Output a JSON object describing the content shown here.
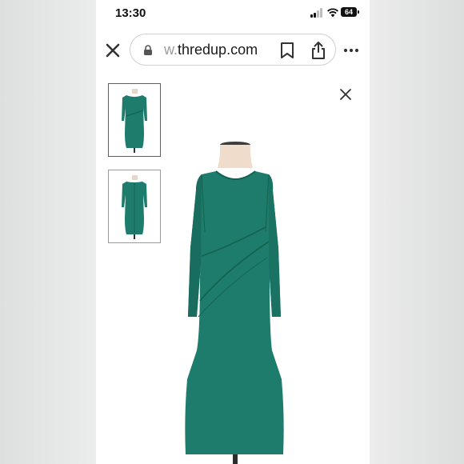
{
  "status_bar": {
    "time": "13:30",
    "battery": "64"
  },
  "browser": {
    "url_prefix": "w.",
    "url_domain": "thredup.com",
    "icons": [
      "close-icon",
      "lock-icon",
      "bookmark-icon",
      "share-icon",
      "more-icon"
    ]
  },
  "viewer": {
    "thumbnails": [
      {
        "label": "front view",
        "selected": true
      },
      {
        "label": "back view",
        "selected": false
      }
    ],
    "close_icon": "close-icon",
    "colors": {
      "dress": "#1e7c6c",
      "dress_shadow": "#15624f",
      "mannequin": "#efdccb"
    }
  }
}
